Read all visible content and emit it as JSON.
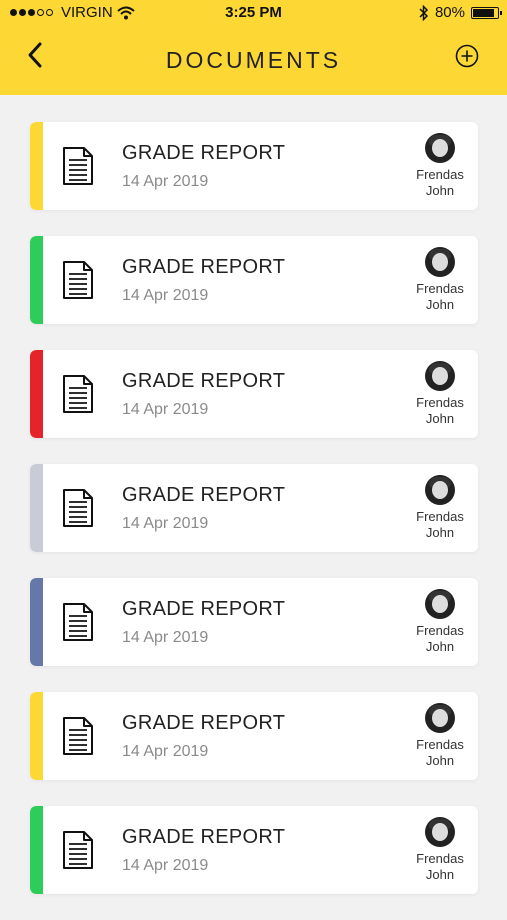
{
  "status_bar": {
    "carrier": "VIRGIN",
    "time": "3:25 PM",
    "battery": "80%",
    "battery_level": 0.8
  },
  "header": {
    "title": "DOCUMENTS",
    "back_icon": "chevron-left-icon",
    "add_icon": "plus-circle-icon"
  },
  "documents": [
    {
      "title": "GRADE REPORT",
      "date": "14 Apr 2019",
      "owner_first": "Frendas",
      "owner_last": "John",
      "color": "#fdd835"
    },
    {
      "title": "GRADE REPORT",
      "date": "14 Apr 2019",
      "owner_first": "Frendas",
      "owner_last": "John",
      "color": "#2ecc59"
    },
    {
      "title": "GRADE REPORT",
      "date": "14 Apr 2019",
      "owner_first": "Frendas",
      "owner_last": "John",
      "color": "#e5232b"
    },
    {
      "title": "GRADE REPORT",
      "date": "14 Apr 2019",
      "owner_first": "Frendas",
      "owner_last": "John",
      "color": "#c9ccd6"
    },
    {
      "title": "GRADE REPORT",
      "date": "14 Apr 2019",
      "owner_first": "Frendas",
      "owner_last": "John",
      "color": "#6678a8"
    },
    {
      "title": "GRADE REPORT",
      "date": "14 Apr 2019",
      "owner_first": "Frendas",
      "owner_last": "John",
      "color": "#fdd835"
    },
    {
      "title": "GRADE REPORT",
      "date": "14 Apr 2019",
      "owner_first": "Frendas",
      "owner_last": "John",
      "color": "#2ecc59"
    }
  ]
}
